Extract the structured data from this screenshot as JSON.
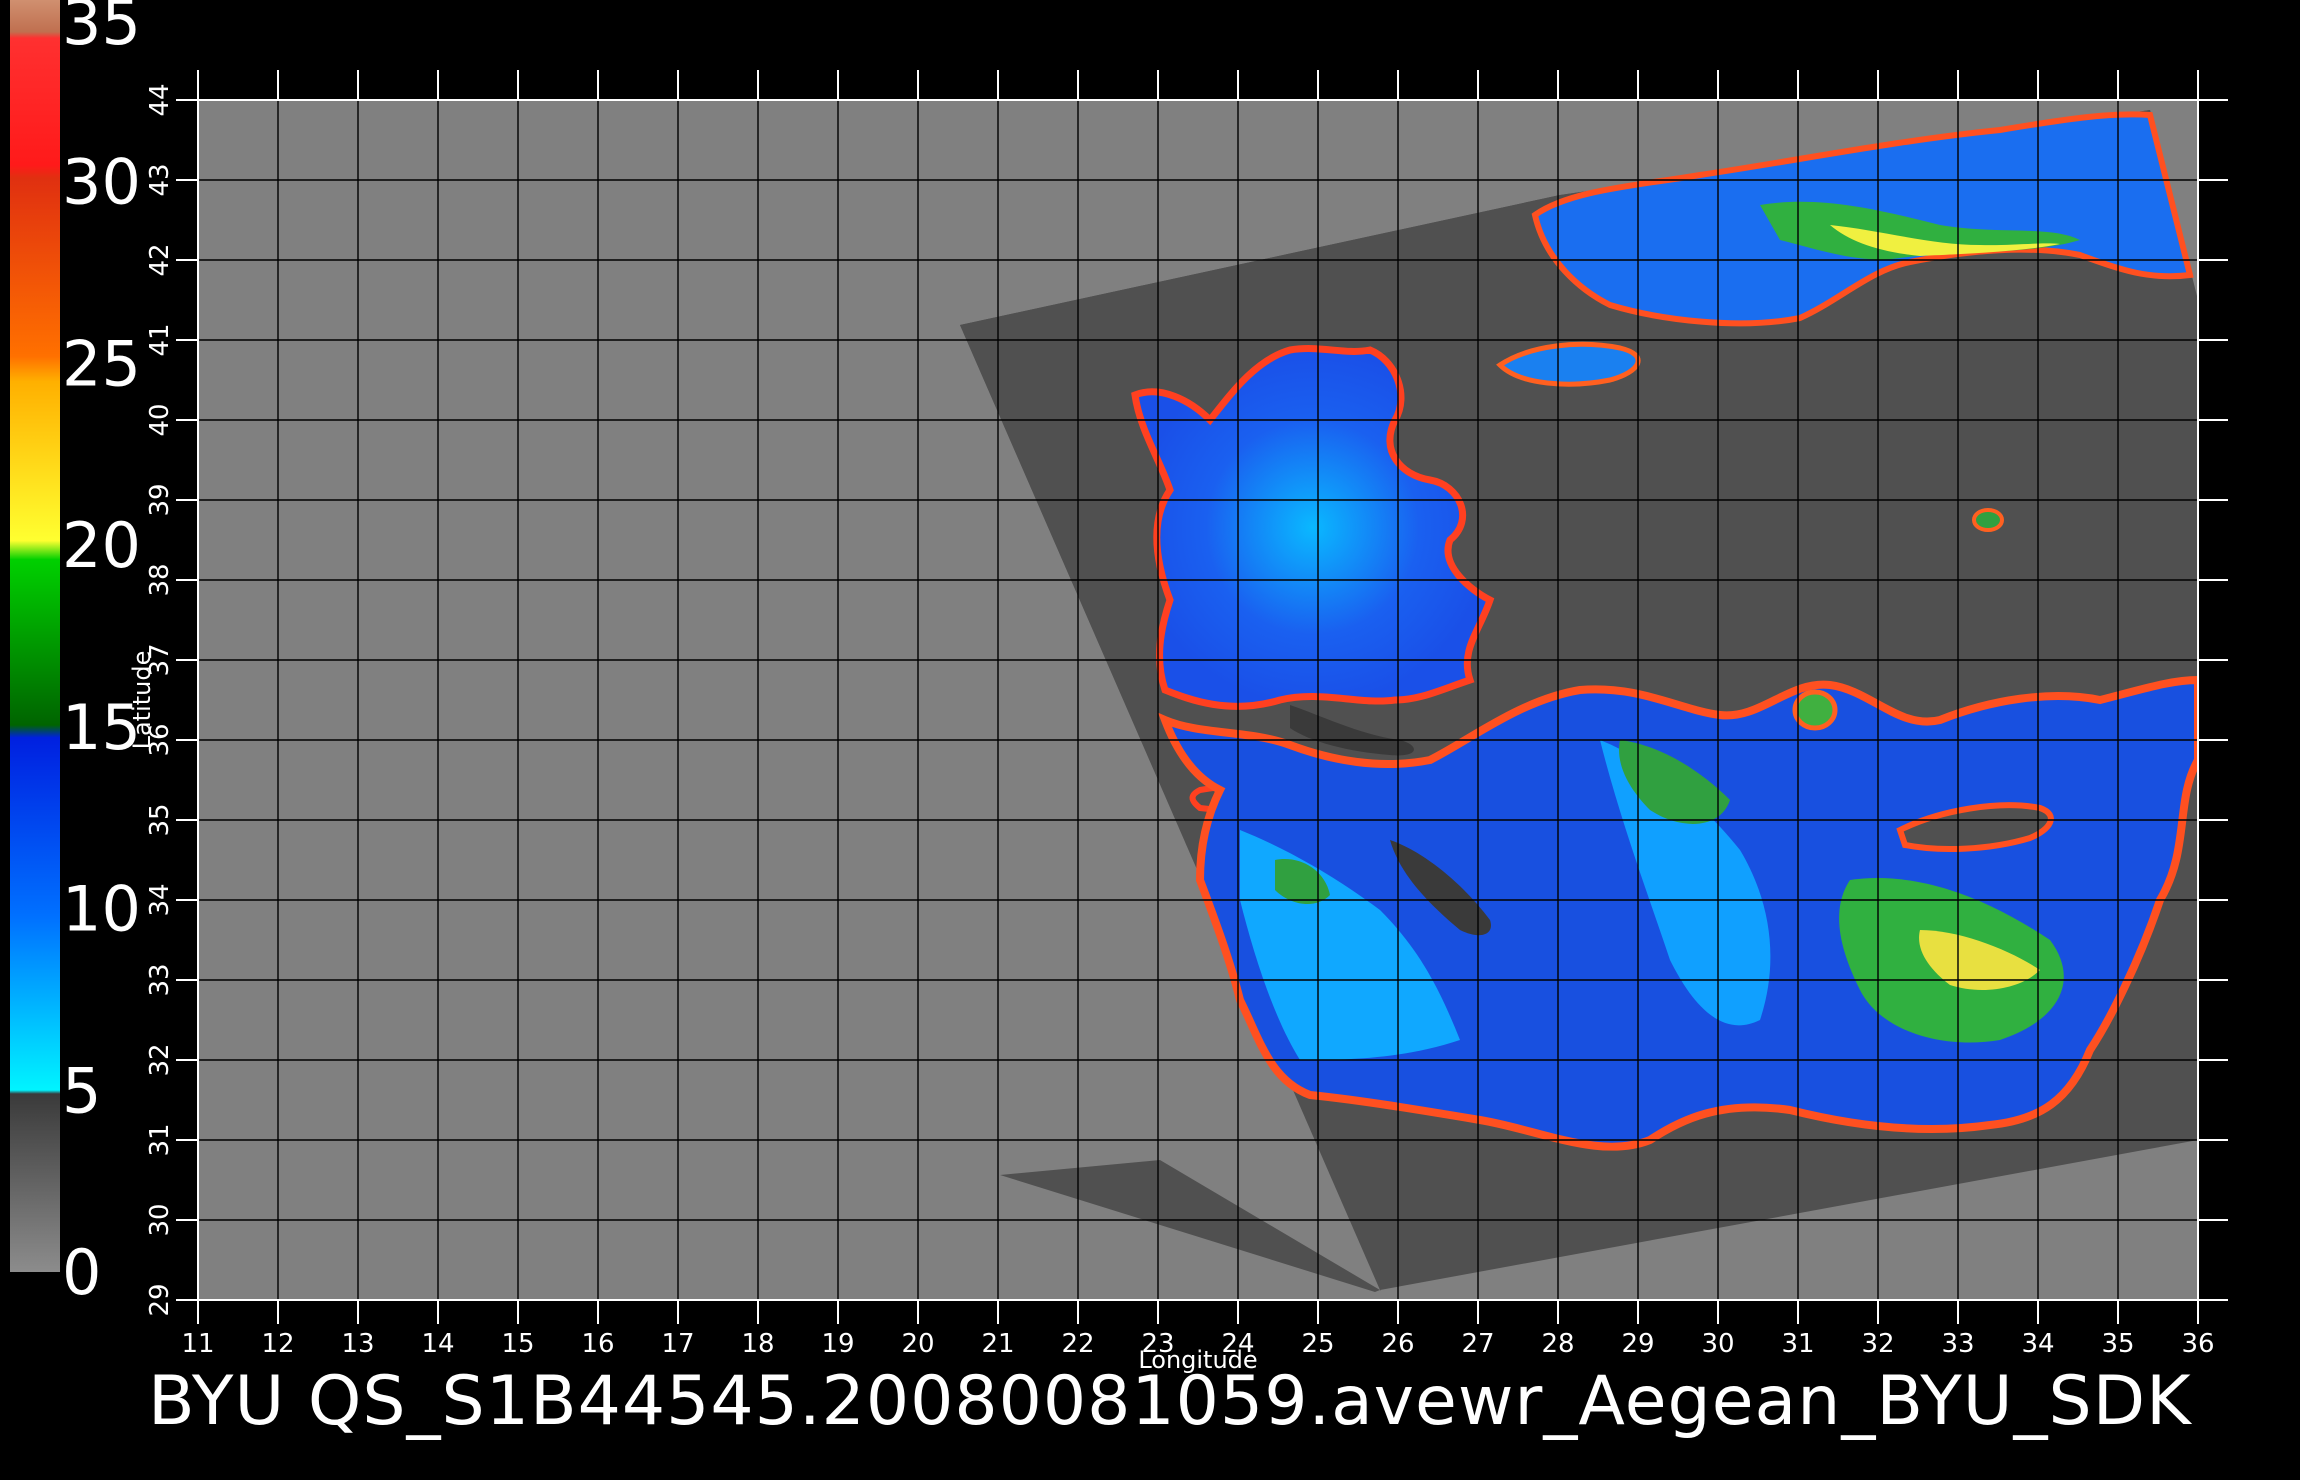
{
  "caption": "BYU  QS_S1B44545.20080081059.avewr_Aegean_BYU_SDK",
  "colorbar": {
    "labels": [
      "0",
      "5",
      "10",
      "15",
      "20",
      "25",
      "30",
      "35"
    ],
    "values": [
      0,
      5,
      10,
      15,
      20,
      25,
      30,
      35
    ]
  },
  "chart_data": {
    "type": "heatmap",
    "xlabel": "Longitude",
    "ylabel": "Latitude",
    "xlim": [
      11,
      36
    ],
    "ylim": [
      29,
      44
    ],
    "x_ticks": [
      "11",
      "12",
      "13",
      "14",
      "15",
      "16",
      "17",
      "18",
      "19",
      "20",
      "21",
      "22",
      "23",
      "24",
      "25",
      "26",
      "27",
      "28",
      "29",
      "30",
      "31",
      "32",
      "33",
      "34",
      "35",
      "36"
    ],
    "y_ticks": [
      "29",
      "30",
      "31",
      "32",
      "33",
      "34",
      "35",
      "36",
      "37",
      "38",
      "39",
      "40",
      "41",
      "42",
      "43",
      "44"
    ],
    "grid": true,
    "colorscale_range": [
      0,
      35
    ],
    "colors": {
      "background": "#000000",
      "land": "#808080",
      "no_data_swath": "#505050",
      "grid": "#000000"
    }
  }
}
